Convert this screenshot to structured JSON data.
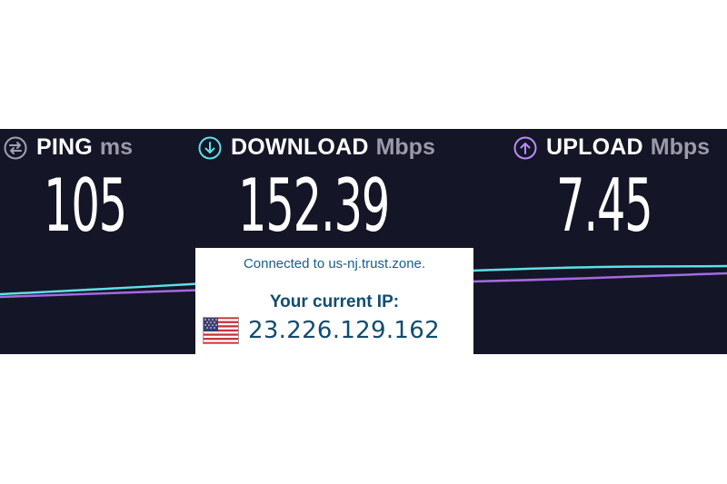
{
  "metrics": [
    {
      "label": "PING",
      "unit": "ms",
      "value": "105",
      "icon": "ping-icon",
      "color": "#a0a0b0"
    },
    {
      "label": "DOWNLOAD",
      "unit": "Mbps",
      "value": "152.39",
      "icon": "download-icon",
      "color": "#5ce1e6"
    },
    {
      "label": "UPLOAD",
      "unit": "Mbps",
      "value": "7.45",
      "icon": "upload-icon",
      "color": "#b98cf5"
    }
  ],
  "connection": {
    "connected_text": "Connected to us-nj.trust.zone.",
    "ip_label": "Your current IP:",
    "ip_value": "23.226.129.162",
    "flag_icon": "us-flag-icon"
  },
  "colors": {
    "panel_bg": "#141526",
    "download_line": "#5ce1e6",
    "upload_line": "#a46ae0",
    "card_text": "#0d4d72"
  }
}
